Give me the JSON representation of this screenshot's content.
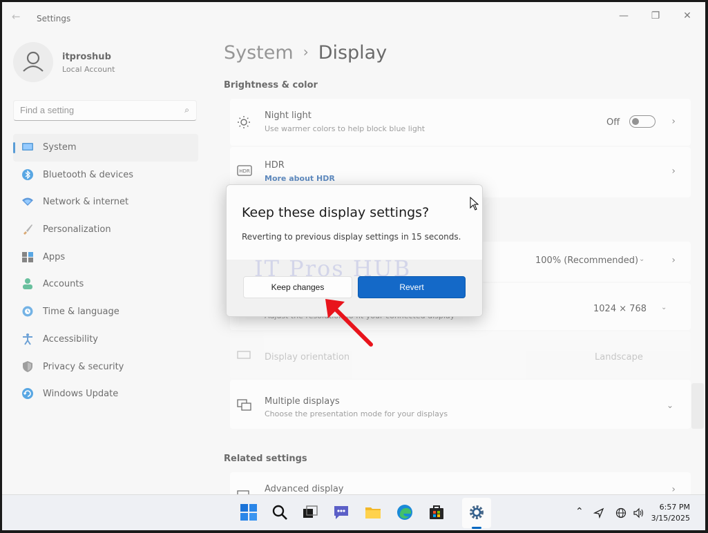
{
  "window": {
    "title": "Settings",
    "minimize_glyph": "—",
    "maximize_glyph": "❐",
    "close_glyph": "✕"
  },
  "account": {
    "name": "itproshub",
    "type": "Local Account"
  },
  "search": {
    "placeholder": "Find a setting"
  },
  "sidebar": {
    "items": [
      {
        "label": "System",
        "icon": "monitor-icon"
      },
      {
        "label": "Bluetooth & devices",
        "icon": "bluetooth-icon"
      },
      {
        "label": "Network & internet",
        "icon": "wifi-icon"
      },
      {
        "label": "Personalization",
        "icon": "brush-icon"
      },
      {
        "label": "Apps",
        "icon": "apps-icon"
      },
      {
        "label": "Accounts",
        "icon": "person-icon"
      },
      {
        "label": "Time & language",
        "icon": "globe-clock-icon"
      },
      {
        "label": "Accessibility",
        "icon": "accessibility-icon"
      },
      {
        "label": "Privacy & security",
        "icon": "shield-icon"
      },
      {
        "label": "Windows Update",
        "icon": "update-icon"
      }
    ]
  },
  "breadcrumb": {
    "parent": "System",
    "separator": "›",
    "current": "Display"
  },
  "sections": {
    "brightness": "Brightness & color",
    "related": "Related settings"
  },
  "settings": {
    "night_light": {
      "title": "Night light",
      "sub": "Use warmer colors to help block blue light",
      "state": "Off"
    },
    "hdr": {
      "title": "HDR",
      "link": "More about HDR"
    },
    "scale": {
      "value": "100% (Recommended)"
    },
    "resolution": {
      "sub": "Adjust the resolution to fit your connected display",
      "value": "1024 × 768"
    },
    "orientation": {
      "title": "Display orientation",
      "value": "Landscape"
    },
    "multiple": {
      "title": "Multiple displays",
      "sub": "Choose the presentation mode for your displays"
    },
    "advanced": {
      "title": "Advanced display"
    }
  },
  "dialog": {
    "title": "Keep these display settings?",
    "message": "Reverting to previous display settings in 15 seconds.",
    "watermark": "IT Pros HUB",
    "keep_label": "Keep changes",
    "revert_label": "Revert"
  },
  "taskbar": {
    "time": "6:57 PM",
    "date": "3/15/2025"
  },
  "colors": {
    "accent": "#0067c0",
    "revert_button": "#1469c8",
    "annotation_arrow": "#e8141c"
  }
}
